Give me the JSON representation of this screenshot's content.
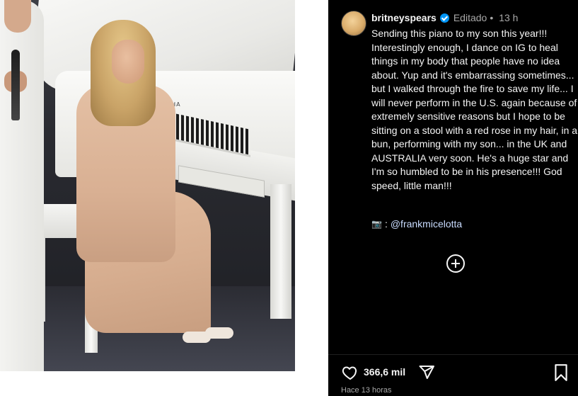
{
  "photo": {
    "piano_brand": "YAMAHA"
  },
  "post": {
    "username": "britneyspears",
    "edited_label": "Editado",
    "separator": "•",
    "time_ago": "13 h",
    "caption": "Sending this piano to my son this year!!! Interestingly enough, I dance on IG to heal things in my body that people have no idea about. Yup and it's embarrassing sometimes... but I walked through the fire to save my life... I will never perform in the U.S. again because of extremely sensitive reasons but I hope to be sitting on a stool with a red rose in my hair, in a bun, performing with my son... in the UK and AUSTRALIA very soon. He's a huge star and I'm so humbled to be in his presence!!! God speed, little man!!!",
    "credit_icon": "📷",
    "credit_colon": ":",
    "credit_mention": "@frankmicelotta",
    "likes": "366,6 mil",
    "timestamp": "Hace 13 horas"
  },
  "icons": {
    "verified": "verified-badge-icon",
    "camera": "camera-icon",
    "more": "plus-circle-icon",
    "like": "heart-icon",
    "share": "paper-plane-icon",
    "save": "bookmark-icon"
  },
  "colors": {
    "panel_bg": "#000000",
    "text": "#f5f5f5",
    "muted": "#a8a8a8",
    "verified": "#0095f6"
  }
}
